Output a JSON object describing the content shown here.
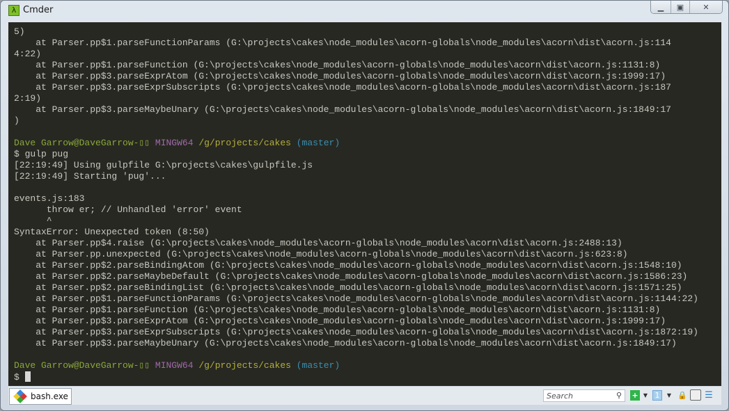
{
  "window": {
    "title": "Cmder",
    "app_icon": "lambda-icon",
    "app_icon_glyph": "λ"
  },
  "terminal": {
    "colors": {
      "background": "#272822",
      "user": "#8aa63a",
      "host": "#a06aa8",
      "path": "#b4ae3a",
      "branch": "#3a8fb0"
    },
    "lines": [
      [
        {
          "t": "5)"
        }
      ],
      [
        {
          "t": "    at Parser.pp$1.parseFunctionParams (G:\\projects\\cakes\\node_modules\\acorn-globals\\node_modules\\acorn\\dist\\acorn.js:114"
        }
      ],
      [
        {
          "t": "4:22)"
        }
      ],
      [
        {
          "t": "    at Parser.pp$1.parseFunction (G:\\projects\\cakes\\node_modules\\acorn-globals\\node_modules\\acorn\\dist\\acorn.js:1131:8)"
        }
      ],
      [
        {
          "t": "    at Parser.pp$3.parseExprAtom (G:\\projects\\cakes\\node_modules\\acorn-globals\\node_modules\\acorn\\dist\\acorn.js:1999:17)"
        }
      ],
      [
        {
          "t": "    at Parser.pp$3.parseExprSubscripts (G:\\projects\\cakes\\node_modules\\acorn-globals\\node_modules\\acorn\\dist\\acorn.js:187"
        }
      ],
      [
        {
          "t": "2:19)"
        }
      ],
      [
        {
          "t": "    at Parser.pp$3.parseMaybeUnary (G:\\projects\\cakes\\node_modules\\acorn-globals\\node_modules\\acorn\\dist\\acorn.js:1849:17"
        }
      ],
      [
        {
          "t": ")"
        }
      ],
      [],
      [
        {
          "t": "Dave Garrow@DaveGarrow-▯▯ ",
          "c": "user"
        },
        {
          "t": "MINGW64 ",
          "c": "host"
        },
        {
          "t": "/g/projects/cakes ",
          "c": "path"
        },
        {
          "t": "(master)",
          "c": "branch"
        }
      ],
      [
        {
          "t": "$ gulp pug"
        }
      ],
      [
        {
          "t": "[22:19:49] Using gulpfile G:\\projects\\cakes\\gulpfile.js"
        }
      ],
      [
        {
          "t": "[22:19:49] Starting 'pug'..."
        }
      ],
      [],
      [
        {
          "t": "events.js:183"
        }
      ],
      [
        {
          "t": "      throw er; // Unhandled 'error' event"
        }
      ],
      [
        {
          "t": "      ^"
        }
      ],
      [
        {
          "t": "SyntaxError: Unexpected token (8:50)"
        }
      ],
      [
        {
          "t": "    at Parser.pp$4.raise (G:\\projects\\cakes\\node_modules\\acorn-globals\\node_modules\\acorn\\dist\\acorn.js:2488:13)"
        }
      ],
      [
        {
          "t": "    at Parser.pp.unexpected (G:\\projects\\cakes\\node_modules\\acorn-globals\\node_modules\\acorn\\dist\\acorn.js:623:8)"
        }
      ],
      [
        {
          "t": "    at Parser.pp$2.parseBindingAtom (G:\\projects\\cakes\\node_modules\\acorn-globals\\node_modules\\acorn\\dist\\acorn.js:1548:10)"
        }
      ],
      [
        {
          "t": "    at Parser.pp$2.parseMaybeDefault (G:\\projects\\cakes\\node_modules\\acorn-globals\\node_modules\\acorn\\dist\\acorn.js:1586:23)"
        }
      ],
      [
        {
          "t": "    at Parser.pp$2.parseBindingList (G:\\projects\\cakes\\node_modules\\acorn-globals\\node_modules\\acorn\\dist\\acorn.js:1571:25)"
        }
      ],
      [
        {
          "t": "    at Parser.pp$1.parseFunctionParams (G:\\projects\\cakes\\node_modules\\acorn-globals\\node_modules\\acorn\\dist\\acorn.js:1144:22)"
        }
      ],
      [
        {
          "t": "    at Parser.pp$1.parseFunction (G:\\projects\\cakes\\node_modules\\acorn-globals\\node_modules\\acorn\\dist\\acorn.js:1131:8)"
        }
      ],
      [
        {
          "t": "    at Parser.pp$3.parseExprAtom (G:\\projects\\cakes\\node_modules\\acorn-globals\\node_modules\\acorn\\dist\\acorn.js:1999:17)"
        }
      ],
      [
        {
          "t": "    at Parser.pp$3.parseExprSubscripts (G:\\projects\\cakes\\node_modules\\acorn-globals\\node_modules\\acorn\\dist\\acorn.js:1872:19)"
        }
      ],
      [
        {
          "t": "    at Parser.pp$3.parseMaybeUnary (G:\\projects\\cakes\\node_modules\\acorn-globals\\node_modules\\acorn\\dist\\acorn.js:1849:17)"
        }
      ],
      [],
      [
        {
          "t": "Dave Garrow@DaveGarrow-▯▯ ",
          "c": "user"
        },
        {
          "t": "MINGW64 ",
          "c": "host"
        },
        {
          "t": "/g/projects/cakes ",
          "c": "path"
        },
        {
          "t": "(master)",
          "c": "branch"
        }
      ],
      [
        {
          "t": "$ "
        },
        {
          "cursor": true
        }
      ]
    ]
  },
  "statusbar": {
    "tab_label": "bash.exe",
    "tab_icon": "git-bash-icon",
    "search_placeholder": "Search",
    "tools": [
      "new-console-icon",
      "dropdown-icon",
      "tab-list-icon",
      "dropdown-icon",
      "lock-icon",
      "split-view-icon",
      "menu-icon"
    ]
  }
}
